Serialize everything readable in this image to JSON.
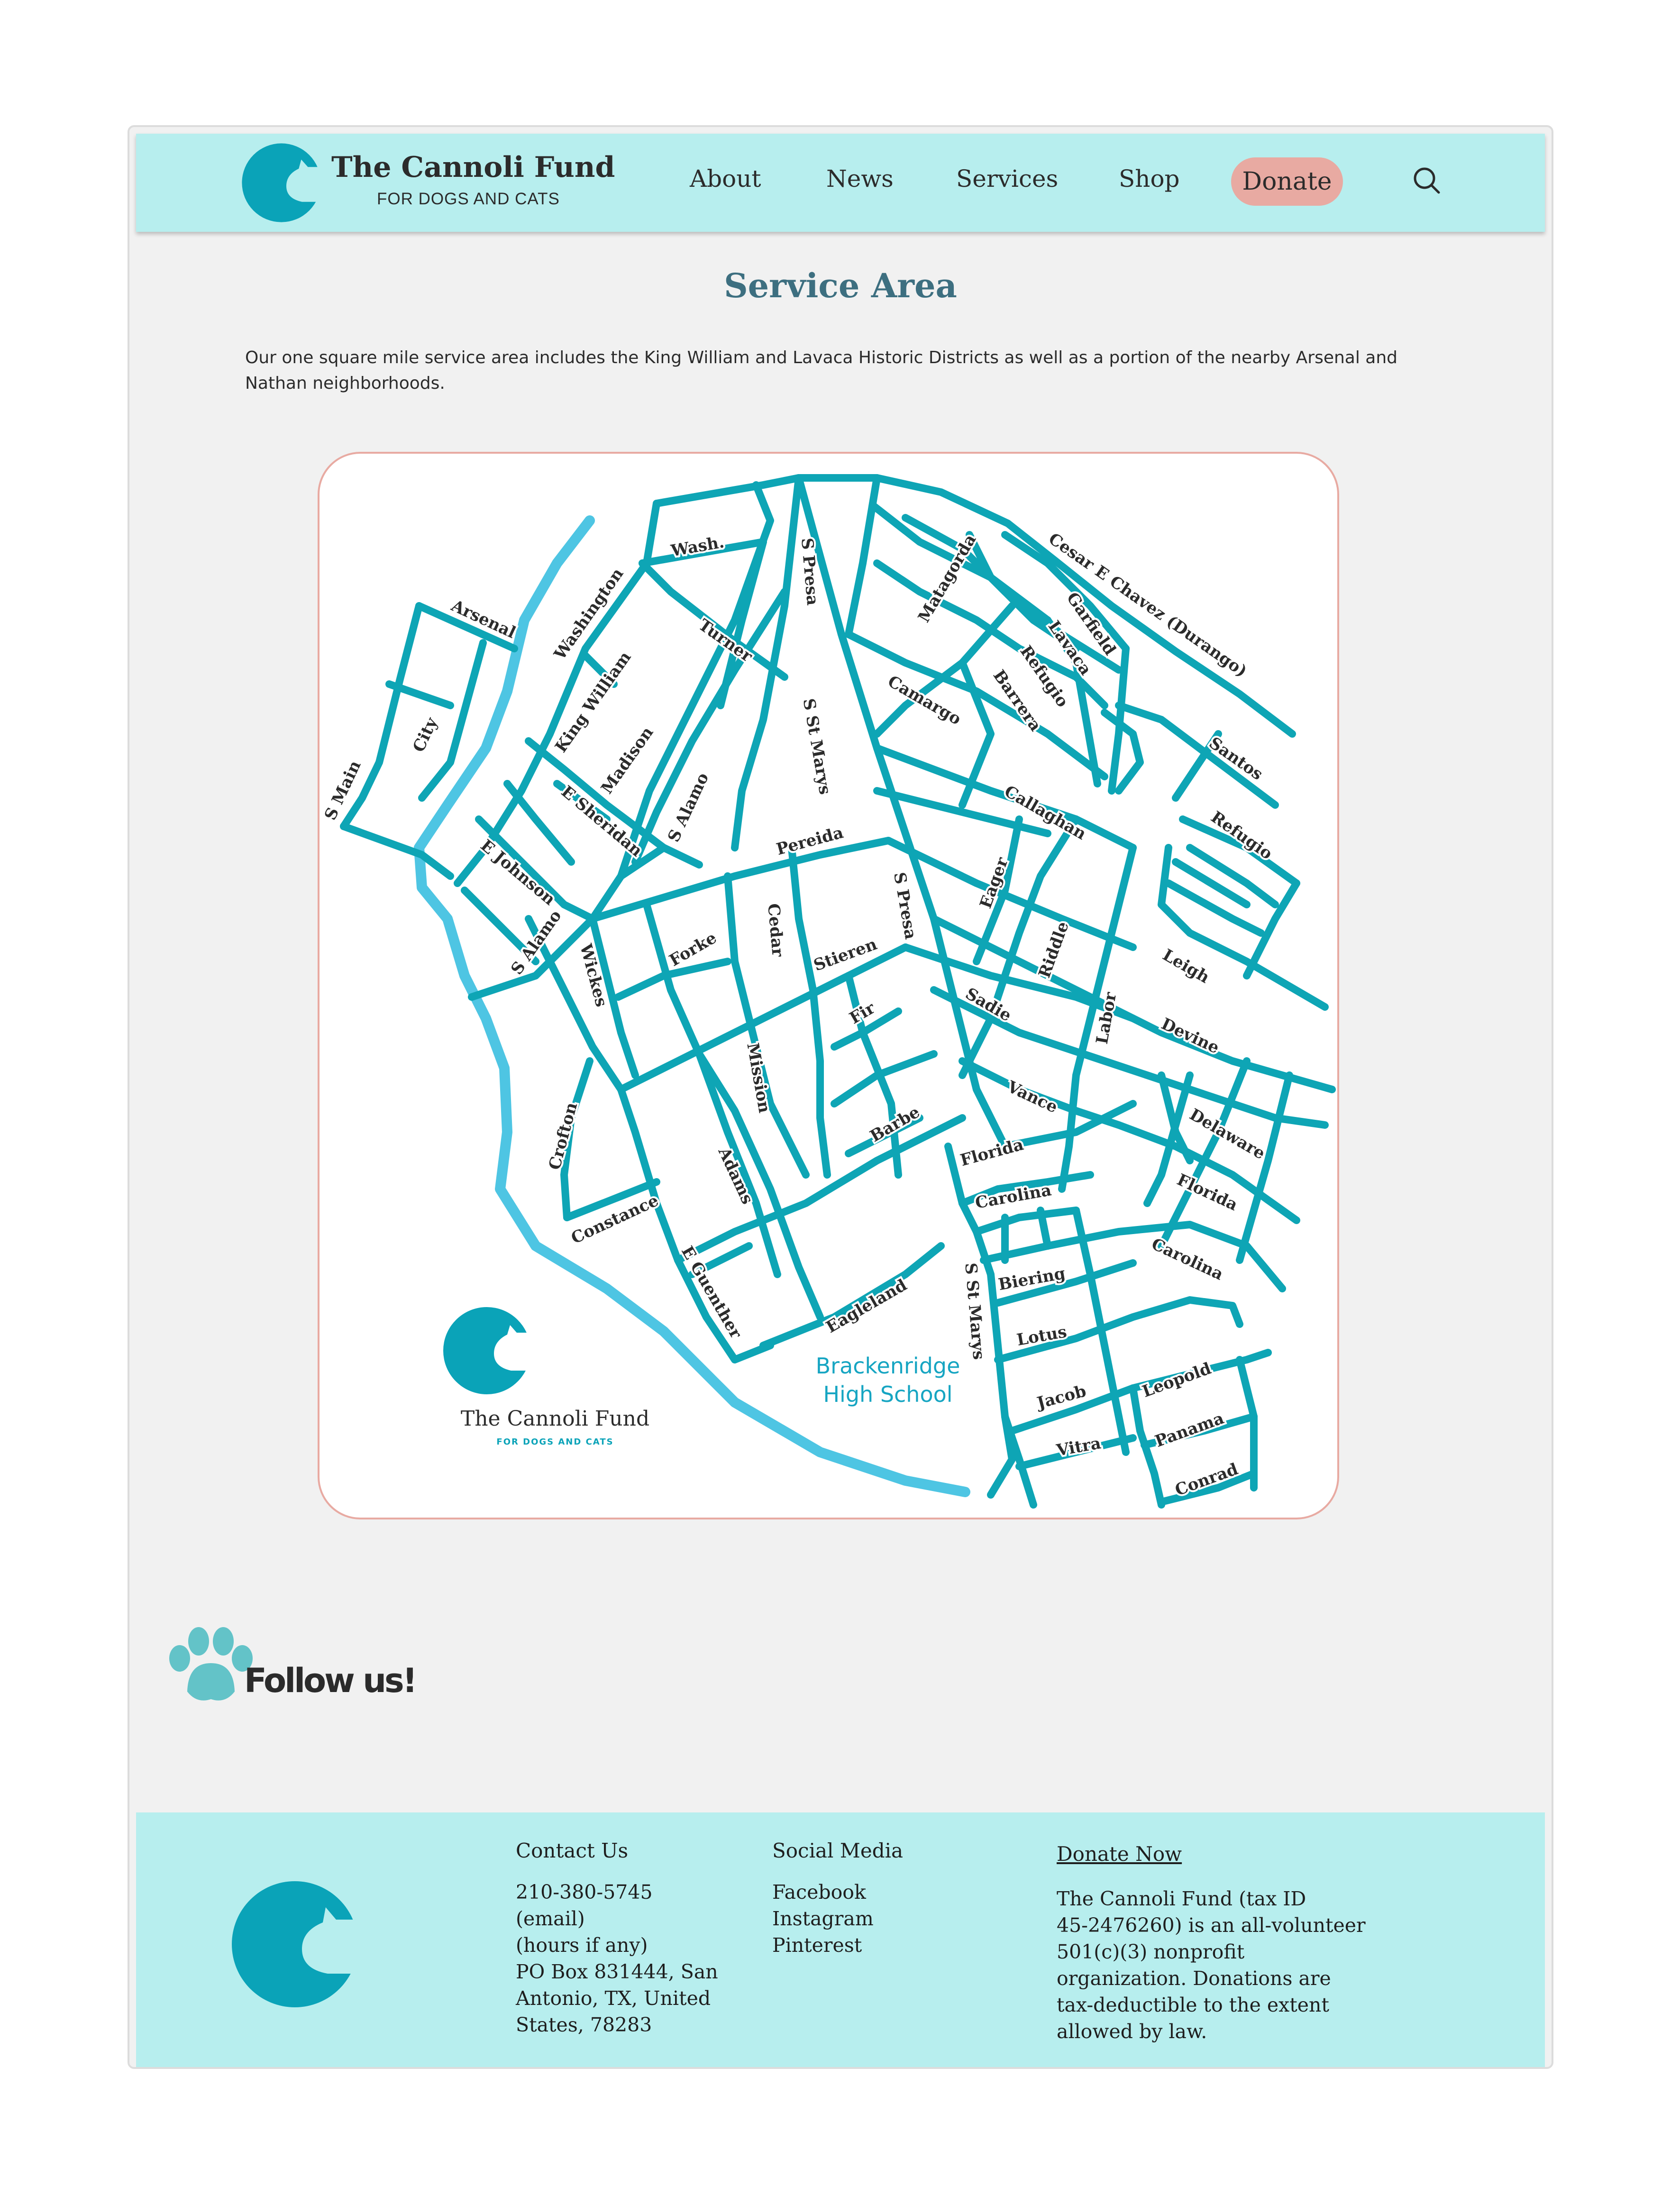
{
  "brand": {
    "name": "The Cannoli Fund",
    "tagline": "FOR DOGS AND CATS"
  },
  "nav": {
    "items": [
      "About",
      "News",
      "Services",
      "Shop"
    ],
    "donate": "Donate"
  },
  "search": {
    "icon": "search-icon"
  },
  "page": {
    "title": "Service Area",
    "intro": "Our one square mile service area includes the King William and Lavaca Historic Districts as well as a portion of the nearby Arsenal and Nathan neighborhoods."
  },
  "map": {
    "logo_name": "The Cannoli Fund",
    "logo_tagline": "FOR DOGS AND CATS",
    "landmark_line1": "Brackenridge",
    "landmark_line2": "High School",
    "street_labels": [
      "Arsenal",
      "Washington",
      "Wash.",
      "Turner",
      "S Presa",
      "Matagorda",
      "Cesar E Chavez (Durango)",
      "Garfield",
      "Lavaca",
      "Refugio",
      "Barrera",
      "Camargo",
      "City",
      "King William",
      "Madison",
      "S Main",
      "E Sheridan",
      "S Alamo",
      "S St Marys",
      "Pereida",
      "Callaghan",
      "Santos",
      "Refugio",
      "E Johnson",
      "S Alamo",
      "Cedar",
      "S Presa",
      "Eager",
      "Forke",
      "Wickes",
      "Stieren",
      "Riddle",
      "Leigh",
      "Fir",
      "Sadie",
      "Labor",
      "Devine",
      "Mission",
      "Vance",
      "Crofton",
      "Barbe",
      "Delaware",
      "Adams",
      "Florida",
      "Florida",
      "Constance",
      "Carolina",
      "Carolina",
      "E Guenther",
      "Biering",
      "S St Marys",
      "Eagleland",
      "Lotus",
      "Leopold",
      "Jacob",
      "Panama",
      "Vitra",
      "Conrad"
    ],
    "colors": {
      "street": "#0ea5b5",
      "river": "#4ec5e3",
      "label": "#2b2b2b",
      "border": "#e8aaa2"
    }
  },
  "follow": {
    "text": "Follow us!",
    "icon": "paw-icon"
  },
  "footer": {
    "contact": {
      "heading": "Contact Us",
      "lines": [
        "210-380-5745",
        "(email)",
        "(hours if any)",
        "PO Box 831444, San",
        "Antonio, TX, United",
        "States, 78283"
      ]
    },
    "social": {
      "heading": "Social Media",
      "links": [
        "Facebook",
        "Instagram",
        "Pinterest"
      ]
    },
    "donate": {
      "heading": "Donate Now",
      "lines": [
        "The Cannoli Fund (tax ID",
        "45-2476260) is an all-volunteer",
        "501(c)(3) nonprofit",
        "organization. Donations are",
        "tax-deductible to the extent",
        "allowed by law."
      ]
    }
  },
  "colors": {
    "header_bg": "#b7eeee",
    "brand_teal": "#0aa3b8",
    "title": "#3d6f80",
    "donate_bg": "#e8aaa2",
    "page_bg": "#f1f1f1"
  }
}
